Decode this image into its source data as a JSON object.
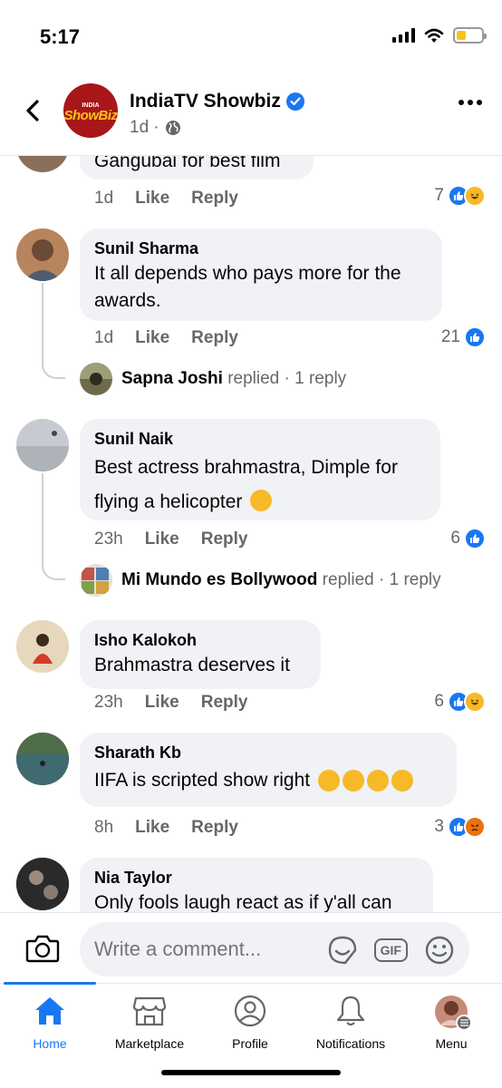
{
  "status_bar": {
    "time": "5:17"
  },
  "header": {
    "page_logo_top": "INDIA",
    "page_logo_main": "ShowBiz",
    "page_name": "IndiaTV Showbiz",
    "post_time": "1d ·"
  },
  "comments": [
    {
      "name": "",
      "text": "Gangubai for best film",
      "time": "1d",
      "like": "Like",
      "reply": "Reply",
      "reaction_count": "7",
      "reactions": [
        "like",
        "haha"
      ]
    },
    {
      "name": "Sunil Sharma",
      "text_line1": "It all depends who pays more for the",
      "text_line2": "awards.",
      "time": "1d",
      "like": "Like",
      "reply": "Reply",
      "reaction_count": "21",
      "reactions": [
        "like"
      ],
      "replies": {
        "name": "Sapna Joshi",
        "action": "replied",
        "count": " · 1 reply"
      }
    },
    {
      "name": "Sunil Naik",
      "text_line1": "Best actress brahmastra, Dimple for",
      "text_line2": "flying a helicopter",
      "emoji": "tears-of-joy",
      "time": "23h",
      "like": "Like",
      "reply": "Reply",
      "reaction_count": "6",
      "reactions": [
        "like"
      ],
      "replies": {
        "name": "Mi Mundo es Bollywood",
        "action": "replied",
        "count": " · 1 reply"
      }
    },
    {
      "name": "Isho Kalokoh",
      "text": "Brahmastra deserves it",
      "time": "23h",
      "like": "Like",
      "reply": "Reply",
      "reaction_count": "6",
      "reactions": [
        "like",
        "haha"
      ]
    },
    {
      "name": "Sharath Kb",
      "text": "IIFA is scripted show right",
      "emojis": [
        "thinking",
        "thinking",
        "rofl",
        "rofl"
      ],
      "time": "8h",
      "like": "Like",
      "reply": "Reply",
      "reaction_count": "3",
      "reactions": [
        "like",
        "angry"
      ]
    },
    {
      "name": "Nia Taylor",
      "text": "Only fools laugh react as if y'all can"
    }
  ],
  "composer": {
    "placeholder": "Write a comment...",
    "gif_label": "GIF"
  },
  "nav": {
    "home": "Home",
    "marketplace": "Marketplace",
    "profile": "Profile",
    "notifications": "Notifications",
    "menu": "Menu",
    "active": "home"
  },
  "colors": {
    "accent": "#1877f2",
    "bubble": "#f0f2f5",
    "secondary_text": "#65676b"
  }
}
